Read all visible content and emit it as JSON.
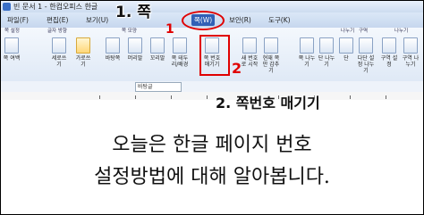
{
  "window": {
    "title": "빈 문서 1 - 한컴오피스 한글"
  },
  "menus": [
    "파일(F)",
    "편집(E)",
    "보기(U)",
    "쪽(W)",
    "보안(R)",
    "도구(K)"
  ],
  "annotations": {
    "step1_label": "1. 쪽",
    "step1_number": "1",
    "step2_label": "2. 쪽번호 매기기",
    "step2_number": "2"
  },
  "ribbon": {
    "groups": [
      "쪽 설정",
      "글자 방향",
      "쪽 모양",
      "나누기",
      "구역",
      "나누기"
    ],
    "buttons": [
      "쪽 여백",
      "세로쓰기",
      "가로쓰기",
      "바탕쪽",
      "머리말",
      "꼬리말",
      "쪽 테두리/배경",
      "쪽 번호 매기기",
      "새 번호로 시작",
      "현재 쪽만 감추기",
      "쪽 나누기",
      "단 나누기",
      "단",
      "다단 설정 나누기",
      "구역 설정",
      "구역 나누기"
    ]
  },
  "format_bar": {
    "style": "바탕글"
  },
  "document": {
    "lines": [
      "오늘은 한글 페이지 번호",
      "설정방법에 대해 알아봅니다."
    ]
  },
  "colors": {
    "annotation_red": "#e00000",
    "menu_active": "#3160b6"
  }
}
